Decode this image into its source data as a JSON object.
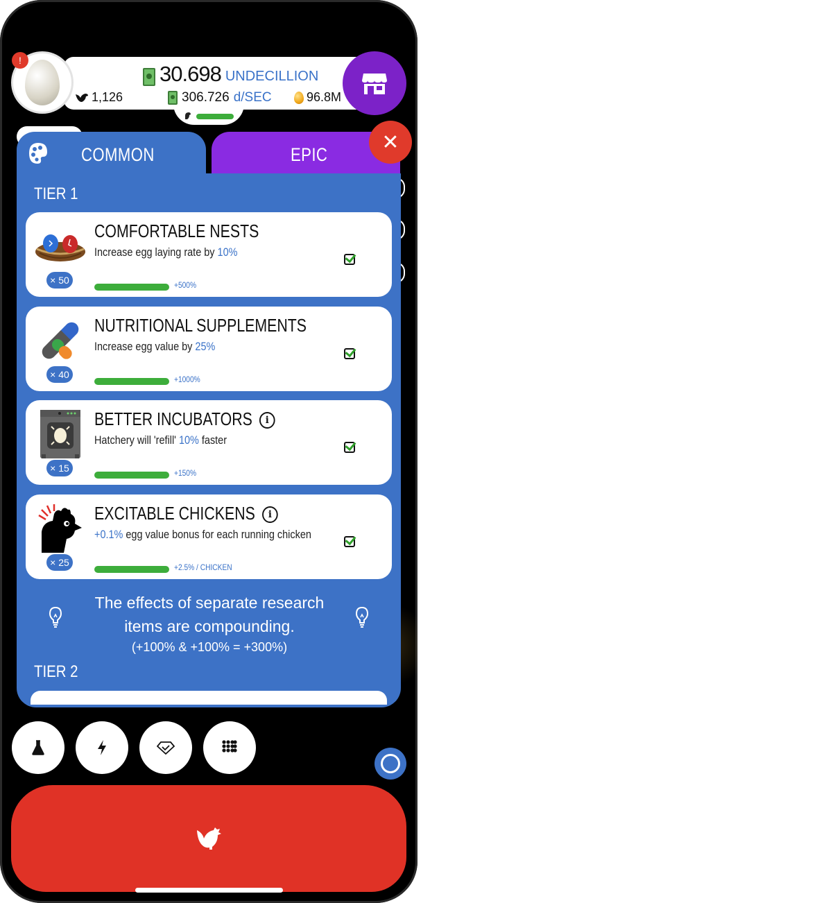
{
  "header": {
    "alert_count": "!",
    "cash_value": "30.698",
    "cash_unit": "UNDECILLION",
    "chicken_count": "1,126",
    "rate_value": "306.726",
    "rate_unit": "d/SEC",
    "golden_eggs": "96.8M"
  },
  "tabs": [
    {
      "label": "COMMON"
    },
    {
      "label": "EPIC"
    }
  ],
  "tiers": {
    "tier1_title": "TIER 1",
    "tier2_title": "TIER 2"
  },
  "research": [
    {
      "title": "COMFORTABLE NESTS",
      "desc_prefix": "Increase egg laying rate by ",
      "desc_value": "10%",
      "desc_suffix": "",
      "badge": "× 50",
      "progress_label": "+500%",
      "progress": 1.0,
      "icon": "nest-icon"
    },
    {
      "title": "NUTRITIONAL SUPPLEMENTS",
      "desc_prefix": "Increase egg value by ",
      "desc_value": "25%",
      "desc_suffix": "",
      "badge": "× 40",
      "progress_label": "+1000%",
      "progress": 1.0,
      "icon": "pill-icon"
    },
    {
      "title": "BETTER INCUBATORS",
      "desc_prefix": "Hatchery will 'refill' ",
      "desc_value": "10%",
      "desc_suffix": " faster",
      "badge": "× 15",
      "progress_label": "+150%",
      "progress": 1.0,
      "icon": "incubator-icon"
    },
    {
      "title": "EXCITABLE CHICKENS",
      "desc_prefix": "",
      "desc_value": "+0.1%",
      "desc_suffix": " egg value bonus for each running chicken",
      "badge": "× 25",
      "progress_label": "+2.5% / CHICKEN",
      "progress": 1.0,
      "icon": "excited-chicken-icon"
    }
  ],
  "tip": {
    "line1": "The effects of separate research items are compounding.",
    "line2": "(+100% & +100% = +300%)"
  },
  "colors": {
    "panel_blue": "#3d72c6",
    "epic_purple": "#8a2be2",
    "shop_purple": "#7c22c8",
    "hatch_red": "#e03226",
    "progress_green": "#3dad3b",
    "highlight_blue": "#3a72c8"
  }
}
